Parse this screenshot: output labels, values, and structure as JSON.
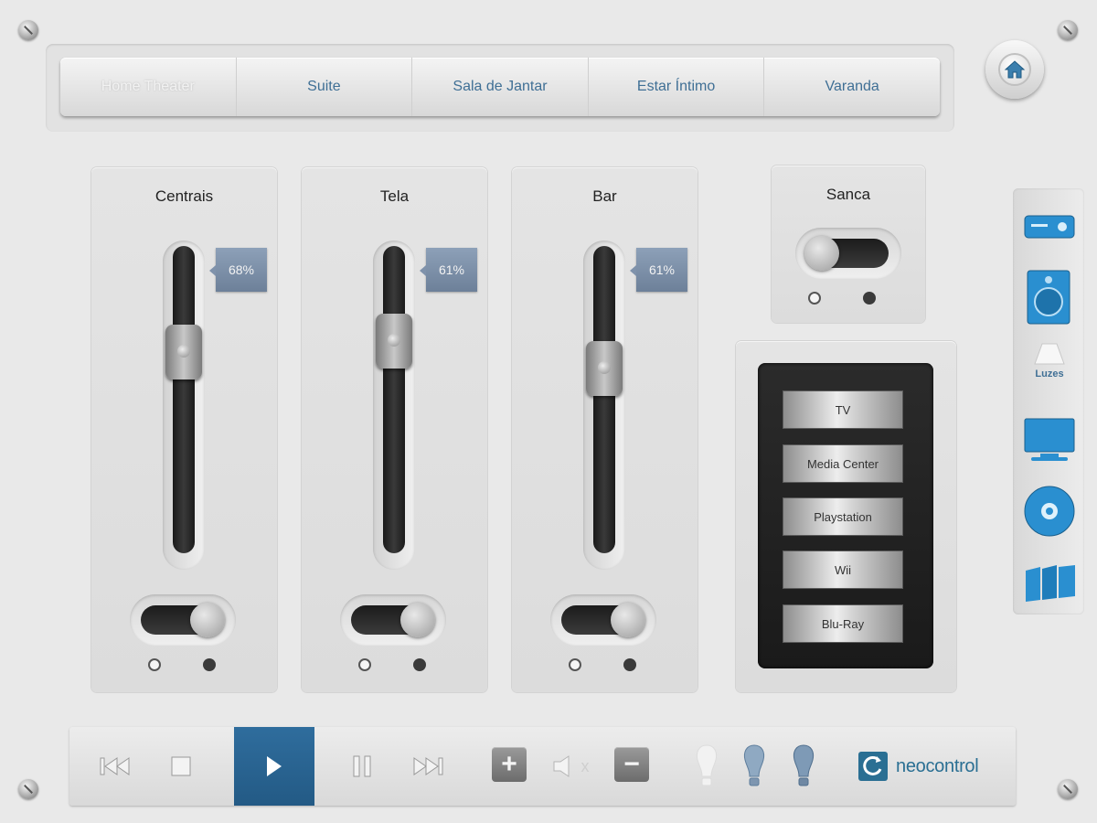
{
  "nav": {
    "tabs": [
      {
        "label": "Home Theater",
        "active": true
      },
      {
        "label": "Suite",
        "active": false
      },
      {
        "label": "Sala de Jantar",
        "active": false
      },
      {
        "label": "Estar Íntimo",
        "active": false
      },
      {
        "label": "Varanda",
        "active": false
      }
    ],
    "home_icon": "home-icon"
  },
  "dimmers": [
    {
      "title": "Centrais",
      "level_label": "68%",
      "level": 0.68,
      "switch_on": true
    },
    {
      "title": "Tela",
      "level_label": "61%",
      "level": 0.61,
      "switch_on": true
    },
    {
      "title": "Bar",
      "level_label": "61%",
      "level": 0.61,
      "switch_on": true
    }
  ],
  "sanca": {
    "title": "Sanca",
    "switch_on": false
  },
  "sources": [
    "TV",
    "Media Center",
    "Playstation",
    "Wii",
    "Blu-Ray"
  ],
  "side_menu": {
    "items": [
      "receiver-icon",
      "speaker-icon",
      "lamp-icon",
      "tv-icon",
      "disc-icon",
      "curtain-icon"
    ],
    "lamp_label": "Luzes"
  },
  "transport": {
    "icons": [
      "previous-icon",
      "stop-icon",
      "play-icon",
      "pause-icon",
      "next-icon"
    ],
    "volume_up": "+",
    "volume_down": "−",
    "mute_mark": "x"
  },
  "brand": {
    "name": "neocontrol"
  },
  "colors": {
    "accent": "#2a6b9b",
    "tab_text": "#3f6f95",
    "percent_badge": "#7a8da6"
  }
}
